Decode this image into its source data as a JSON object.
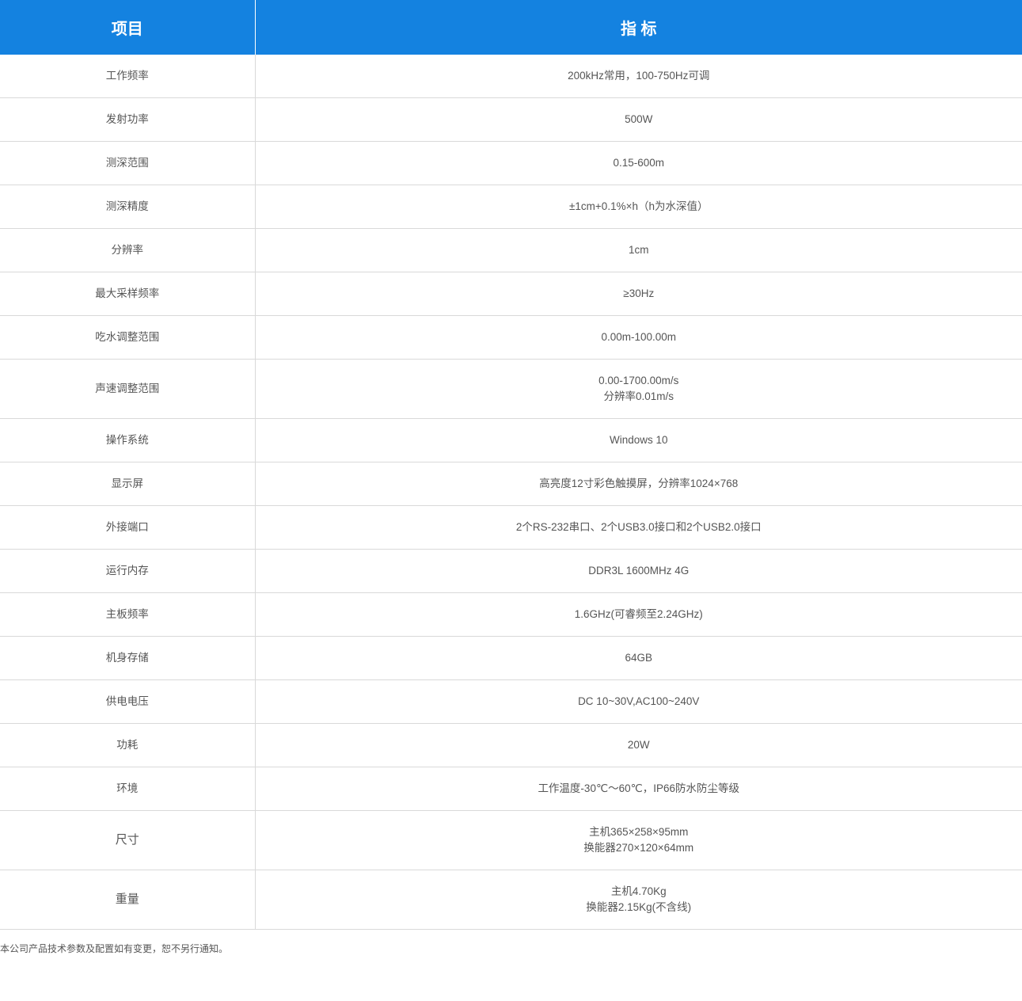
{
  "header": {
    "item": "项目",
    "spec": "指 标"
  },
  "rows": [
    {
      "name": "工作频率",
      "value": [
        "200kHz常用，100-750Hz可调"
      ]
    },
    {
      "name": "发射功率",
      "value": [
        "500W"
      ]
    },
    {
      "name": "测深范围",
      "value": [
        "0.15-600m"
      ]
    },
    {
      "name": "测深精度",
      "value": [
        "±1cm+0.1%×h（h为水深值）"
      ]
    },
    {
      "name": "分辨率",
      "value": [
        "1cm"
      ]
    },
    {
      "name": "最大采样频率",
      "value": [
        "≥30Hz"
      ]
    },
    {
      "name": "吃水调整范围",
      "value": [
        "0.00m-100.00m"
      ]
    },
    {
      "name": "声速调整范围",
      "value": [
        "0.00-1700.00m/s",
        "分辨率0.01m/s"
      ]
    },
    {
      "name": "操作系统",
      "value": [
        "Windows 10"
      ]
    },
    {
      "name": "显示屏",
      "value": [
        "高亮度12寸彩色触摸屏，分辨率1024×768"
      ]
    },
    {
      "name": "外接端口",
      "value": [
        "2个RS-232串口、2个USB3.0接口和2个USB2.0接口"
      ]
    },
    {
      "name": "运行内存",
      "value": [
        "DDR3L 1600MHz 4G"
      ]
    },
    {
      "name": "主板频率",
      "value": [
        "1.6GHz(可睿频至2.24GHz)"
      ]
    },
    {
      "name": "机身存储",
      "value": [
        "64GB"
      ]
    },
    {
      "name": "供电电压",
      "value": [
        "DC 10~30V,AC100~240V"
      ]
    },
    {
      "name": "功耗",
      "value": [
        "20W"
      ]
    },
    {
      "name": "环境",
      "value": [
        "工作温度-30℃～60℃，IP66防水防尘等级"
      ]
    },
    {
      "name": "尺寸",
      "value": [
        "主机365×258×95mm",
        "换能器270×120×64mm"
      ]
    },
    {
      "name": "重量",
      "value": [
        "主机4.70Kg",
        "换能器2.15Kg(不含线)"
      ]
    }
  ],
  "footnote": "本公司产品技术参数及配置如有变更，恕不另行通知。",
  "colors": {
    "header_bg": "#1482e0",
    "header_text": "#ffffff",
    "body_text": "#555555",
    "border": "#d9d9d9"
  }
}
